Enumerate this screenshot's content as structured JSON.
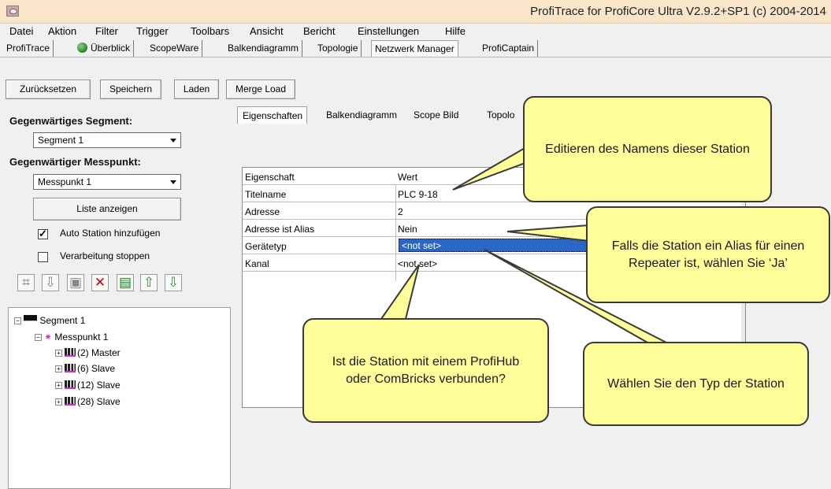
{
  "titlebar": {
    "title": "ProfiTrace for ProfiCore Ultra V2.9.2+SP1 (c) 2004-2014"
  },
  "menu": [
    "Datei",
    "Aktion",
    "Filter",
    "Trigger",
    "Toolbars",
    "Ansicht",
    "Bericht",
    "Einstellungen",
    "Hilfe"
  ],
  "tabs": [
    "ProfiTrace",
    "Überblick",
    "ScopeWare",
    "Balkendiagramm",
    "Topologie",
    "Netzwerk Manager",
    "ProfiCaptain"
  ],
  "toolbar": {
    "reset": "Zurücksetzen",
    "save": "Speichern",
    "load": "Laden",
    "merge": "Merge Load"
  },
  "left": {
    "segment_label": "Gegenwärtiges Segment:",
    "segment_value": "Segment 1",
    "measurement_label": "Gegenwärtiger Messpunkt:",
    "measurement_value": "Messpunkt 1",
    "list_button": "Liste anzeigen",
    "auto_station": "Auto Station hinzufügen",
    "stop_processing": "Verarbeitung stoppen",
    "tree": {
      "segment": "Segment 1",
      "measurement": "Messpunkt 1",
      "stations": [
        "(2) Master",
        "(6) Slave",
        "(12) Slave",
        "(28) Slave"
      ]
    }
  },
  "detail_tabs": [
    "Eigenschaften",
    "Balkendiagramm",
    "Scope Bild",
    "Topolo"
  ],
  "properties": {
    "headers": [
      "Eigenschaft",
      "Wert"
    ],
    "rows": [
      {
        "name": "Titelname",
        "value": "PLC 9-18"
      },
      {
        "name": "Adresse",
        "value": "2"
      },
      {
        "name": "Adresse ist Alias",
        "value": "Nein"
      },
      {
        "name": "Gerätetyp",
        "value": "<not set>"
      },
      {
        "name": "Kanal",
        "value": "<not set>"
      }
    ]
  },
  "callouts": {
    "edit_name": "Editieren des Namens dieser Station",
    "alias": "Falls die Station ein Alias für einen Repeater ist, wählen Sie ‘Ja’",
    "hub": "Ist die Station mit einem ProfiHub oder ComBricks verbunden?",
    "type": "Wählen Sie den Typ der Station"
  },
  "colors": {
    "titlebar": "#f9e5c9",
    "callout": "#fffd99",
    "selection": "#2a67c5",
    "accent_magenta": "#d22bd2"
  },
  "icons": [
    "app-icon",
    "green-status-icon",
    "toolbar-icons",
    "segment-icon",
    "measurement-icon",
    "station-icon"
  ]
}
